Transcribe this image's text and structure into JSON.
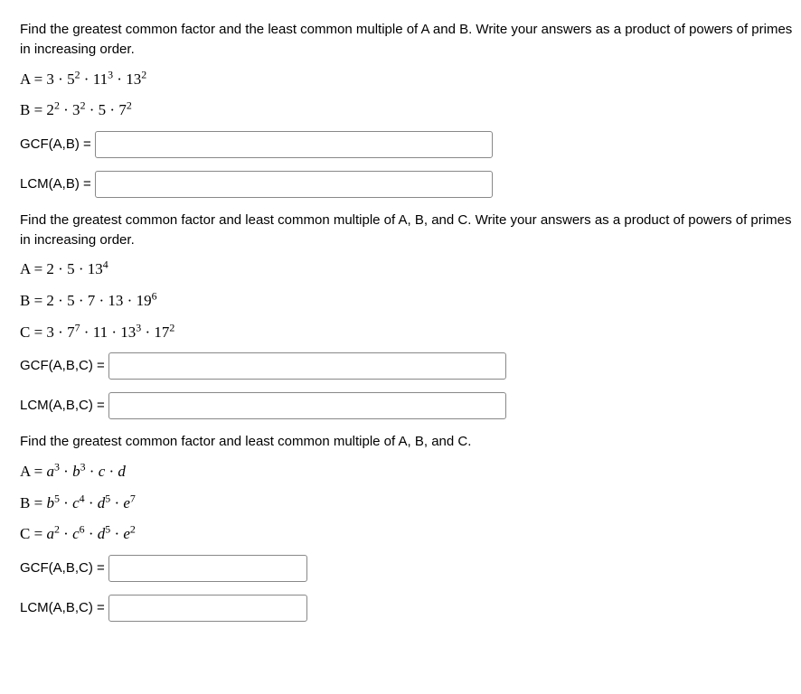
{
  "q1": {
    "prompt": "Find the greatest common factor and the least common multiple of A and B.  Write your answers as a product of powers of primes in increasing order.",
    "lineA_pre": "A = 3 · 5",
    "lineA_exp1": "2",
    "lineA_mid1": " · 11",
    "lineA_exp2": "3",
    "lineA_mid2": " · 13",
    "lineA_exp3": "2",
    "lineB_pre": "B = 2",
    "lineB_exp1": "2",
    "lineB_mid1": " · 3",
    "lineB_exp2": "2",
    "lineB_mid2": " · 5 · 7",
    "lineB_exp3": "2",
    "gcf_label": "GCF(A,B) = ",
    "lcm_label": "LCM(A,B) = "
  },
  "q2": {
    "prompt": "Find the greatest common factor and least common multiple of A, B, and C.  Write your answers as a product of powers of primes in increasing order.",
    "lineA_pre": "A = 2 · 5 · 13",
    "lineA_exp1": "4",
    "lineB_pre": "B = 2 · 5 · 7 · 13 · 19",
    "lineB_exp1": "6",
    "lineC_pre": "C = 3 · 7",
    "lineC_exp1": "7",
    "lineC_mid1": " · 11 · 13",
    "lineC_exp2": "3",
    "lineC_mid2": " · 17",
    "lineC_exp3": "2",
    "gcf_label": "GCF(A,B,C) = ",
    "lcm_label": "LCM(A,B,C) = "
  },
  "q3": {
    "prompt": "Find the greatest common factor and least common multiple of A, B, and C.",
    "A_lhs": "A = ",
    "A_a": "a",
    "A_a_exp": "3",
    "A_dot1": " · ",
    "A_b": "b",
    "A_b_exp": "3",
    "A_dot2": " · ",
    "A_c": "c",
    "A_dot3": " · ",
    "A_d": "d",
    "B_lhs": "B = ",
    "B_b": "b",
    "B_b_exp": "5",
    "B_dot1": " · ",
    "B_c": "c",
    "B_c_exp": "4",
    "B_dot2": " · ",
    "B_d": "d",
    "B_d_exp": "5",
    "B_dot3": " · ",
    "B_e": "e",
    "B_e_exp": "7",
    "C_lhs": "C = ",
    "C_a": "a",
    "C_a_exp": "2",
    "C_dot1": " · ",
    "C_c": "c",
    "C_c_exp": "6",
    "C_dot2": " · ",
    "C_d": "d",
    "C_d_exp": "5",
    "C_dot3": " · ",
    "C_e": "e",
    "C_e_exp": "2",
    "gcf_label": "GCF(A,B,C) = ",
    "lcm_label": "LCM(A,B,C) = "
  }
}
